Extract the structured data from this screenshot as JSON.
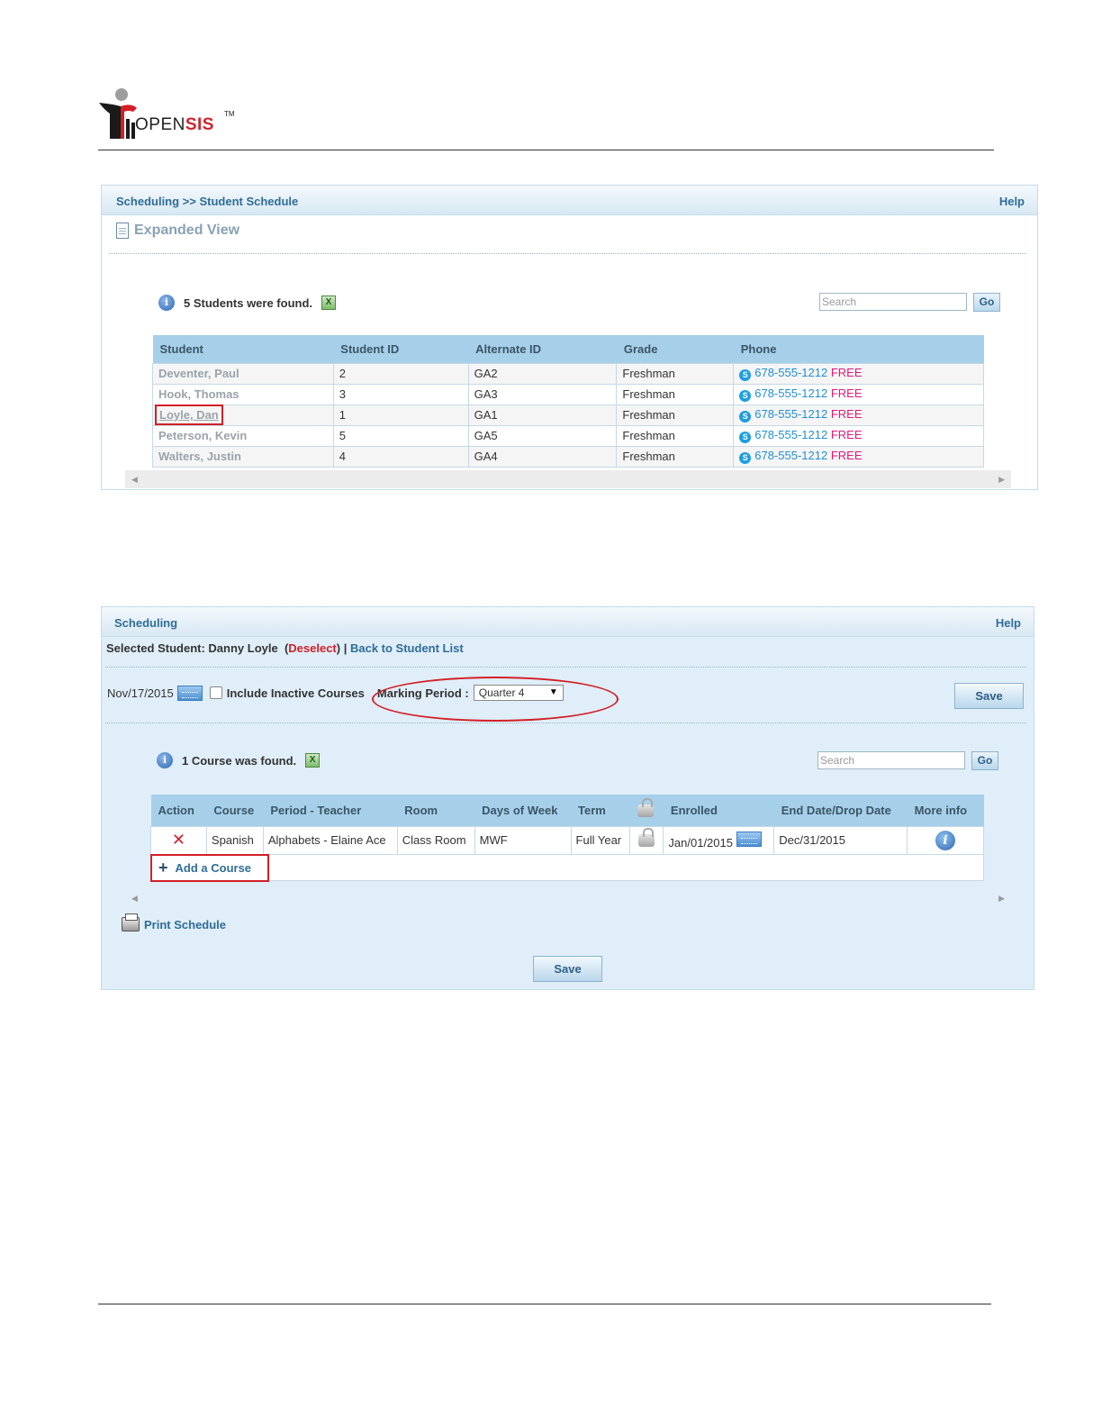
{
  "logo": {
    "open": "OPEN",
    "sis": "SIS",
    "tm": "TM"
  },
  "panel1": {
    "breadcrumb": "Scheduling >> Student Schedule",
    "help": "Help",
    "view_label": "Expanded View",
    "found_text": "5 Students were found.",
    "search_placeholder": "Search",
    "go_label": "Go",
    "columns": [
      "Student",
      "Student ID",
      "Alternate ID",
      "Grade",
      "Phone"
    ],
    "rows": [
      {
        "name": "Deventer, Paul",
        "id": "2",
        "alt": "GA2",
        "grade": "Freshman",
        "phone": "678-555-1212",
        "free": "FREE"
      },
      {
        "name": "Hook, Thomas",
        "id": "3",
        "alt": "GA3",
        "grade": "Freshman",
        "phone": "678-555-1212",
        "free": "FREE"
      },
      {
        "name": "Loyle, Dan",
        "id": "1",
        "alt": "GA1",
        "grade": "Freshman",
        "phone": "678-555-1212",
        "free": "FREE"
      },
      {
        "name": "Peterson, Kevin",
        "id": "5",
        "alt": "GA5",
        "grade": "Freshman",
        "phone": "678-555-1212",
        "free": "FREE"
      },
      {
        "name": "Walters, Justin",
        "id": "4",
        "alt": "GA4",
        "grade": "Freshman",
        "phone": "678-555-1212",
        "free": "FREE"
      }
    ]
  },
  "panel2": {
    "title": "Scheduling",
    "help": "Help",
    "selected_prefix": "Selected Student: Danny Loyle",
    "deselect": "Deselect",
    "back_link": "Back to Student List",
    "date": "Nov/17/2015",
    "include_inactive": "Include Inactive Courses",
    "marking_period_label": "Marking Period :",
    "marking_period_value": "Quarter 4",
    "save_label": "Save",
    "found_text": "1 Course was found.",
    "search_placeholder": "Search",
    "go_label": "Go",
    "columns": [
      "Action",
      "Course",
      "Period - Teacher",
      "Room",
      "Days of Week",
      "Term",
      "",
      "Enrolled",
      "End Date/Drop Date",
      "More info"
    ],
    "course_row": {
      "course": "Spanish",
      "period_teacher": "Alphabets - Elaine Ace",
      "room": "Class Room",
      "days": "MWF",
      "term": "Full Year",
      "enrolled": "Jan/01/2015",
      "end_date": "Dec/31/2015"
    },
    "add_course": "Add a Course",
    "print_schedule": "Print Schedule"
  },
  "colors": {
    "link": "#2f6d97",
    "highlight": "#d31f26",
    "header_bg": "#a6cfe9",
    "panel_bg": "#dfeef8",
    "free": "#e2187c"
  }
}
